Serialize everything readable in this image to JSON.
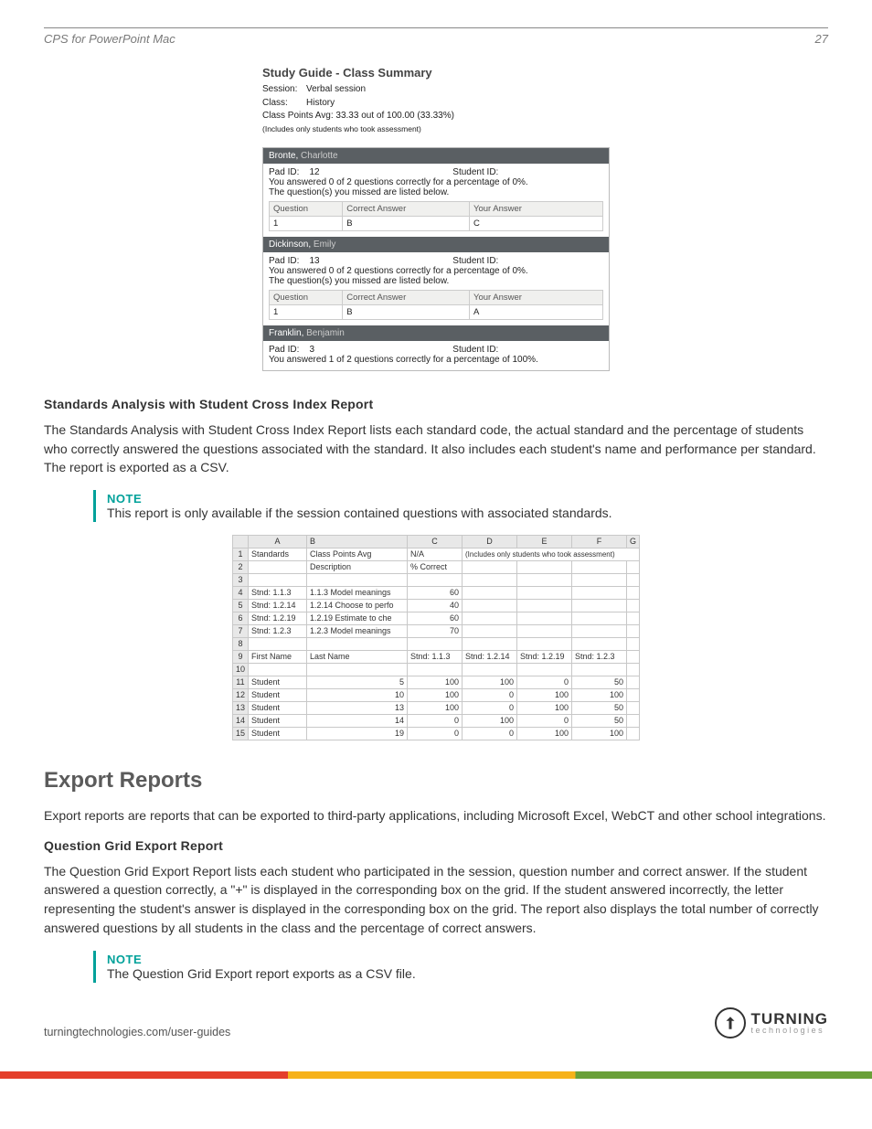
{
  "header": {
    "doc_title": "CPS for PowerPoint Mac",
    "page_number": "27"
  },
  "study_guide": {
    "title": "Study Guide - Class Summary",
    "session_label": "Session:",
    "session": "Verbal session",
    "class_label": "Class:",
    "class": "History",
    "avg_line": "Class Points Avg: 33.33 out of 100.00 (33.33%)",
    "includes_note": "(Includes only students who took assessment)",
    "columns": {
      "q": "Question",
      "ca": "Correct Answer",
      "ya": "Your Answer"
    },
    "labels": {
      "pad": "Pad ID:",
      "sid": "Student ID:",
      "missed": "The question(s) you missed are listed below."
    },
    "students": [
      {
        "last": "Bronte",
        "first": "Charlotte",
        "pad": "12",
        "summary": "You answered 0 of 2 questions correctly for a percentage of 0%.",
        "rows": [
          {
            "q": "1",
            "ca": "B",
            "ya": "C"
          }
        ]
      },
      {
        "last": "Dickinson",
        "first": "Emily",
        "pad": "13",
        "summary": "You answered 0 of 2 questions correctly for a percentage of 0%.",
        "rows": [
          {
            "q": "1",
            "ca": "B",
            "ya": "A"
          }
        ]
      },
      {
        "last": "Franklin",
        "first": "Benjamin",
        "pad": "3",
        "summary": "You answered 1 of 2 questions correctly for a percentage of 100%.",
        "rows": []
      }
    ]
  },
  "section1": {
    "heading": "Standards Analysis with Student Cross Index Report",
    "para": "The Standards Analysis with Student Cross Index Report lists each standard code, the actual standard and the percentage of students who correctly answered the questions associated with the standard. It also includes each student's name and performance per standard. The report is exported as a CSV."
  },
  "note1": {
    "label": "NOTE",
    "text": "This report is only available if the session contained questions with associated standards."
  },
  "spreadsheet": {
    "cols": [
      "A",
      "B",
      "C",
      "D",
      "E",
      "F",
      "G"
    ],
    "rows": [
      {
        "n": "1",
        "A": "Standards",
        "B": "Class Points Avg",
        "C": "N/A",
        "D": "(Includes only students who took assessment)",
        "span": true
      },
      {
        "n": "2",
        "A": "",
        "B": "Description",
        "C": "% Correct"
      },
      {
        "n": "3"
      },
      {
        "n": "4",
        "A": "Stnd: 1.1.3",
        "B": "1.1.3 Model meanings",
        "C": "60",
        "rC": true
      },
      {
        "n": "5",
        "A": "Stnd: 1.2.14",
        "B": "1.2.14 Choose to perfo",
        "C": "40",
        "rC": true
      },
      {
        "n": "6",
        "A": "Stnd: 1.2.19",
        "B": "1.2.19 Estimate to che",
        "C": "60",
        "rC": true
      },
      {
        "n": "7",
        "A": "Stnd: 1.2.3",
        "B": "1.2.3 Model meanings",
        "C": "70",
        "rC": true
      },
      {
        "n": "8"
      },
      {
        "n": "9",
        "A": "First Name",
        "B": "Last Name",
        "C": "Stnd: 1.1.3",
        "D": "Stnd: 1.2.14",
        "E": "Stnd: 1.2.19",
        "F": "Stnd: 1.2.3"
      },
      {
        "n": "10"
      },
      {
        "n": "11",
        "A": "Student",
        "B": "5",
        "C": "100",
        "D": "100",
        "E": "0",
        "F": "50",
        "rB": true,
        "rAll": true
      },
      {
        "n": "12",
        "A": "Student",
        "B": "10",
        "C": "100",
        "D": "0",
        "E": "100",
        "F": "100",
        "rB": true,
        "rAll": true
      },
      {
        "n": "13",
        "A": "Student",
        "B": "13",
        "C": "100",
        "D": "0",
        "E": "100",
        "F": "50",
        "rB": true,
        "rAll": true
      },
      {
        "n": "14",
        "A": "Student",
        "B": "14",
        "C": "0",
        "D": "100",
        "E": "0",
        "F": "50",
        "rB": true,
        "rAll": true
      },
      {
        "n": "15",
        "A": "Student",
        "B": "19",
        "C": "0",
        "D": "0",
        "E": "100",
        "F": "100",
        "rB": true,
        "rAll": true
      }
    ]
  },
  "export": {
    "heading": "Export Reports",
    "para": "Export reports are reports that can be exported to third-party applications, including Microsoft Excel, WebCT and other school integrations."
  },
  "section2": {
    "heading": "Question Grid Export Report",
    "para": "The Question Grid Export Report lists each student who participated in the session, question number and correct answer. If the student answered a question correctly, a \"+\" is displayed in the corresponding box on the grid. If the student answered incorrectly, the letter representing the student's answer is displayed in the corresponding box on the grid. The report also displays the total number of correctly answered questions by all students in the class and the percentage of correct answers."
  },
  "note2": {
    "label": "NOTE",
    "text": "The Question Grid Export report exports as a CSV file."
  },
  "footer": {
    "url": "turningtechnologies.com/user-guides",
    "logo_big": "TURNING",
    "logo_small": "technologies"
  }
}
